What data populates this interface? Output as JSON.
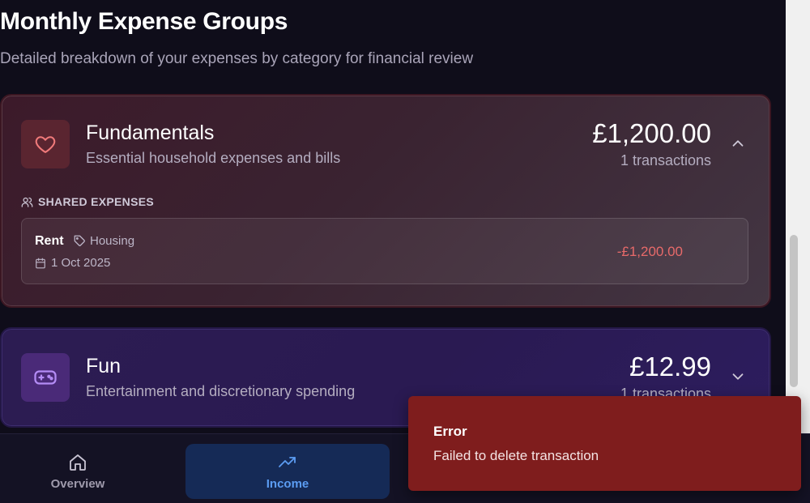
{
  "header": {
    "title": "Monthly Expense Groups",
    "subtitle": "Detailed breakdown of your expenses by category for financial review"
  },
  "groups": [
    {
      "name": "Fundamentals",
      "description": "Essential household expenses and bills",
      "amount": "£1,200.00",
      "count": "1 transactions",
      "icon": "heart-icon",
      "expanded": true,
      "section_label": "SHARED EXPENSES",
      "transactions": [
        {
          "name": "Rent",
          "category": "Housing",
          "date": "1 Oct 2025",
          "amount": "-£1,200.00"
        }
      ]
    },
    {
      "name": "Fun",
      "description": "Entertainment and discretionary spending",
      "amount": "£12.99",
      "count": "1 transactions",
      "icon": "gamepad-icon",
      "expanded": false
    }
  ],
  "nav": {
    "items": [
      {
        "label": "Overview",
        "icon": "home-icon",
        "active": false
      },
      {
        "label": "Income",
        "icon": "trending-up-icon",
        "active": true
      }
    ]
  },
  "toast": {
    "title": "Error",
    "message": "Failed to delete transaction"
  },
  "colors": {
    "background": "#0f0d1a",
    "fundamentals_card": "#3c1a2a",
    "fun_card": "#2c1c52",
    "negative_amount": "#e86a6a",
    "nav_active": "#5b9cf2",
    "toast_error": "#7f1d1d"
  }
}
